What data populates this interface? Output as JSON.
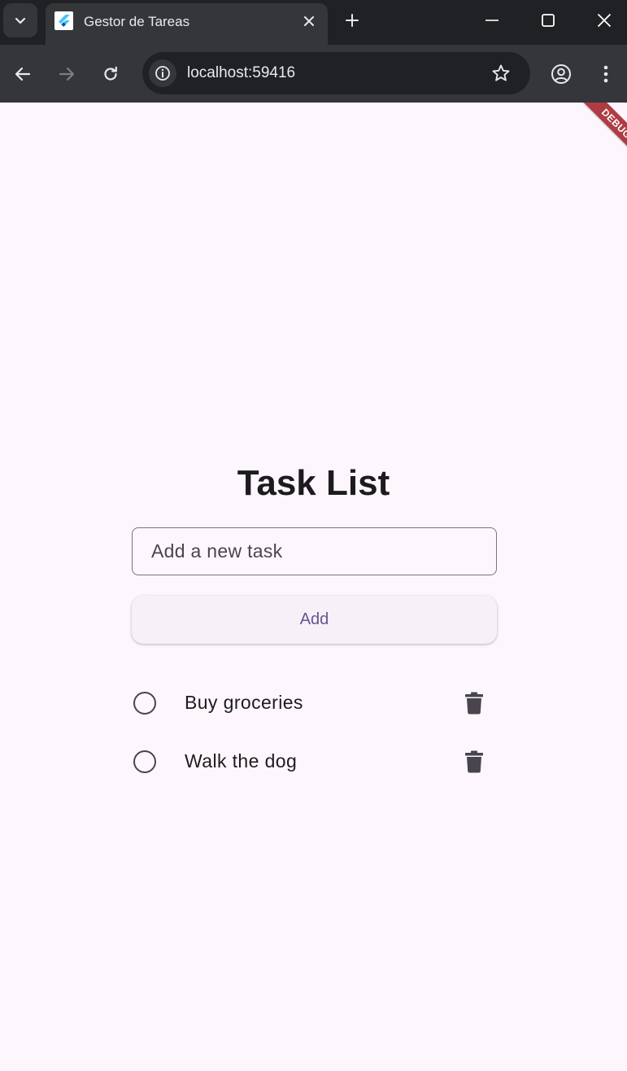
{
  "browser": {
    "tab_title": "Gestor de Tareas",
    "url": "localhost:59416"
  },
  "app": {
    "debug_banner": "DEBUG",
    "title": "Task List",
    "input_placeholder": "Add a new task",
    "input_value": "",
    "add_button_label": "Add",
    "tasks": [
      {
        "label": "Buy groceries",
        "done": false
      },
      {
        "label": "Walk the dog",
        "done": false
      }
    ]
  },
  "icons": {
    "tab_search": "chevron-down-icon",
    "favicon": "flutter-icon",
    "tab_close": "close-icon",
    "new_tab": "plus-icon",
    "back": "arrow-left-icon",
    "forward": "arrow-right-icon",
    "reload": "reload-icon",
    "site_info": "info-icon",
    "bookmark": "star-icon",
    "profile": "account-circle-icon",
    "menu": "more-vert-icon",
    "task_toggle": "radio-unchecked-icon",
    "task_delete": "trash-icon"
  },
  "colors": {
    "page_background": "#fdf7fd",
    "title_text": "#1d1b20",
    "button_text": "#65558f",
    "button_background": "#f6f0f8",
    "outline": "#79747e",
    "icon": "#49454f",
    "debug_banner": "#b03c43",
    "chrome_dark": "#202124",
    "chrome_tab": "#35363a"
  }
}
